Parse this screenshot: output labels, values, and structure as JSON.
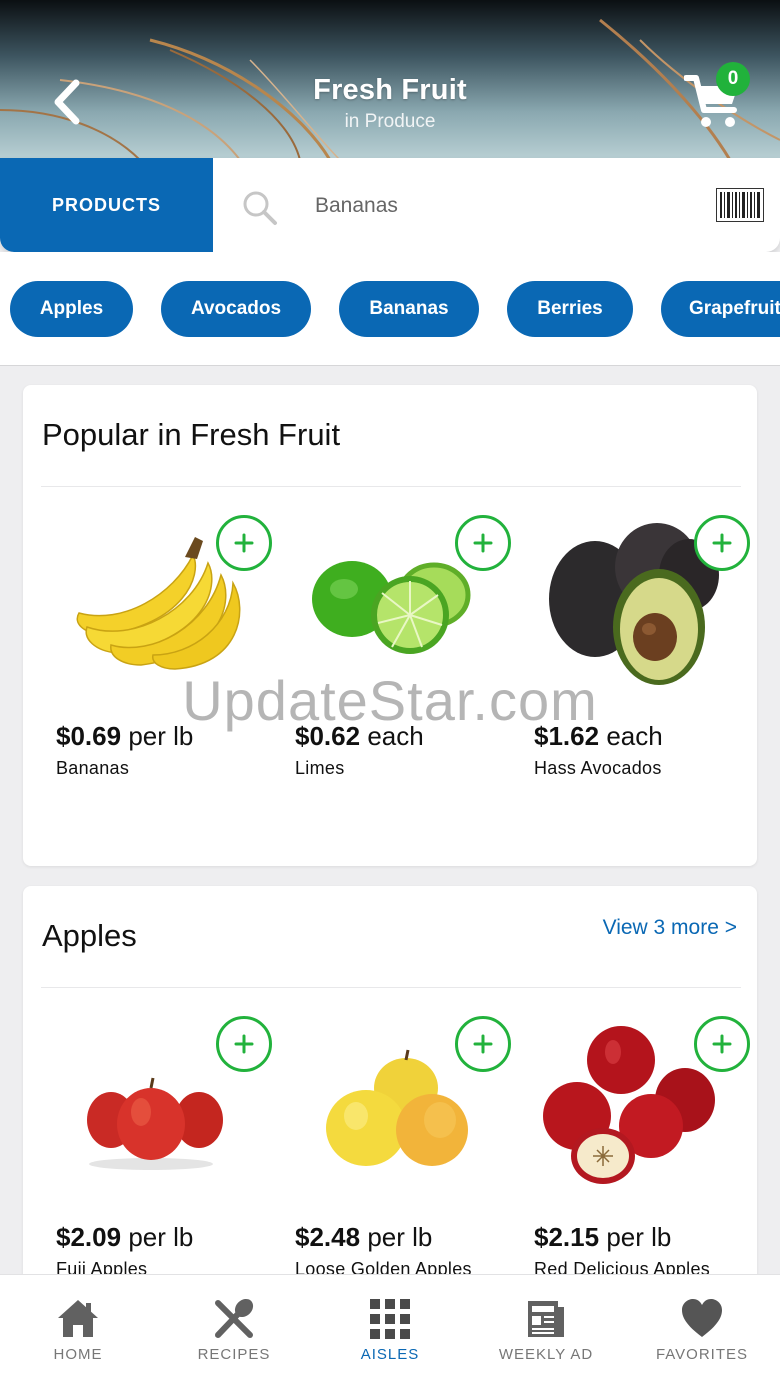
{
  "header": {
    "title": "Fresh Fruit",
    "subtitle": "in Produce",
    "cart_count": "0"
  },
  "search": {
    "tab_label": "PRODUCTS",
    "placeholder": "Bananas"
  },
  "categories": [
    "Apples",
    "Avocados",
    "Bananas",
    "Berries",
    "Grapefruit"
  ],
  "popular": {
    "title": "Popular in Fresh Fruit",
    "items": [
      {
        "price": "$0.69",
        "unit": "per lb",
        "name": "Bananas"
      },
      {
        "price": "$0.62",
        "unit": "each",
        "name": "Limes"
      },
      {
        "price": "$1.62",
        "unit": "each",
        "name": "Hass Avocados"
      }
    ]
  },
  "apples": {
    "title": "Apples",
    "view_more": "View 3 more >",
    "items": [
      {
        "price": "$2.09",
        "unit": "per lb",
        "name": "Fuji Apples"
      },
      {
        "price": "$2.48",
        "unit": "per lb",
        "name": "Loose Golden Apples"
      },
      {
        "price": "$2.15",
        "unit": "per lb",
        "name": "Red Delicious Apples"
      }
    ]
  },
  "watermark": "UpdateStar.com",
  "nav": [
    {
      "label": "HOME",
      "icon": "home-icon"
    },
    {
      "label": "RECIPES",
      "icon": "utensils-icon"
    },
    {
      "label": "AISLES",
      "icon": "grid-icon",
      "active": true
    },
    {
      "label": "WEEKLY AD",
      "icon": "newspaper-icon"
    },
    {
      "label": "FAVORITES",
      "icon": "heart-icon"
    }
  ],
  "colors": {
    "primary": "#0a68b4",
    "add_green": "#22b23c",
    "badge_green": "#21b23b"
  }
}
